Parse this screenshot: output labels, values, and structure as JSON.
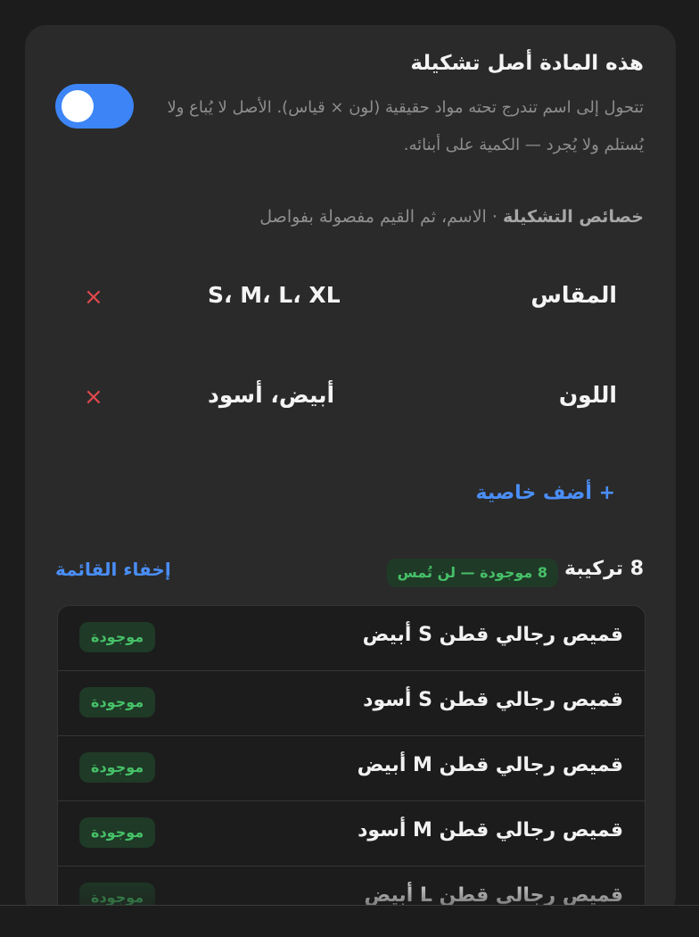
{
  "header": {
    "title": "هذه المادة أصل تشكيلة",
    "description": "تتحول إلى اسم تندرج تحته مواد حقيقية (لون × قياس). الأصل لا يُباع ولا يُستلم ولا يُجرد — الكمية على أبنائه.",
    "toggle_on": true
  },
  "properties": {
    "label_bold": "خصائص التشكيلة",
    "label_rest": " · الاسم، ثم القيم مفصولة بفواصل",
    "items": [
      {
        "name": "المقاس",
        "values": "S، M، L، XL"
      },
      {
        "name": "اللون",
        "values": "أبيض، أسود"
      }
    ],
    "remove_icon": "×",
    "add_label": "+ أضف خاصية"
  },
  "combinations": {
    "count_label": "8 تركيبة",
    "badge": "8 موجودة — لن تُمس",
    "hide_label": "إخفاء القائمة",
    "rows": [
      {
        "name": "قميص رجالي قطن S أبيض",
        "status": "موجودة"
      },
      {
        "name": "قميص رجالي قطن S أسود",
        "status": "موجودة"
      },
      {
        "name": "قميص رجالي قطن M أبيض",
        "status": "موجودة"
      },
      {
        "name": "قميص رجالي قطن M أسود",
        "status": "موجودة"
      },
      {
        "name": "قميص رجالي قطن L أبيض",
        "status": "موجودة"
      }
    ]
  },
  "colors": {
    "accent": "#3d85f6",
    "success": "#46c068",
    "danger": "#e0494e"
  }
}
